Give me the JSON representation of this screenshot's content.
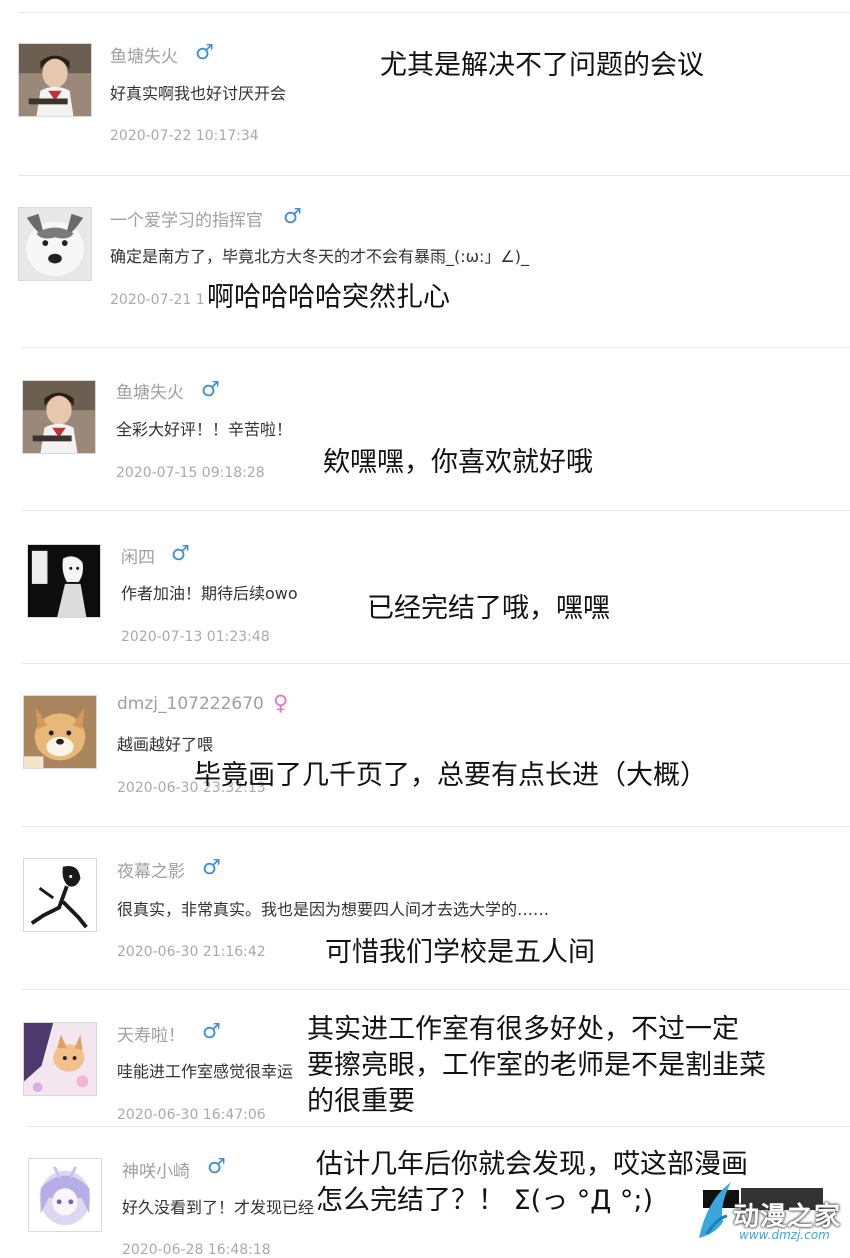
{
  "colors": {
    "male": "#3f8fd8",
    "female": "#e777c4",
    "username": "#a0a0a0",
    "timestamp": "#aaaaaa",
    "divider": "#e6e6e6"
  },
  "comments": [
    {
      "username": "鱼塘失火",
      "gender_icon": "♂",
      "gender": "male",
      "text": "好真实啊我也好讨厌开会",
      "time": "2020-07-22 10:17:34",
      "reply": "尤其是解决不了问题的会议"
    },
    {
      "username": "一个爱学习的指挥官",
      "gender_icon": "♂",
      "gender": "male",
      "text": "确定是南方了，毕竟北方大冬天的才不会有暴雨_(:ω:」∠)_",
      "time": "2020-07-21 1",
      "reply": "啊哈哈哈哈突然扎心"
    },
    {
      "username": "鱼塘失火",
      "gender_icon": "♂",
      "gender": "male",
      "text": "全彩大好评！！辛苦啦！",
      "time": "2020-07-15 09:18:28",
      "reply": "欸嘿嘿，你喜欢就好哦"
    },
    {
      "username": "闲四",
      "gender_icon": "♂",
      "gender": "male",
      "text": "作者加油！期待后续owo",
      "time": "2020-07-13 01:23:48",
      "reply": "已经完结了哦，嘿嘿"
    },
    {
      "username": "dmzj_107222670",
      "gender_icon": "♀",
      "gender": "female",
      "text": "越画越好了喂",
      "time": "2020-06-30 23:32:13",
      "reply": "毕竟画了几千页了，总要有点长进（大概）"
    },
    {
      "username": "夜幕之影",
      "gender_icon": "♂",
      "gender": "male",
      "text": "很真实，非常真实。我也是因为想要四人间才去选大学的……",
      "time": "2020-06-30 21:16:42",
      "reply": "可惜我们学校是五人间"
    },
    {
      "username": "天寿啦！",
      "gender_icon": "♂",
      "gender": "male",
      "text": "哇能进工作室感觉很幸运",
      "time": "2020-06-30 16:47:06",
      "reply_lines": [
        "其实进工作室有很多好处，不过一定",
        "要擦亮眼，工作室的老师是不是割韭菜",
        "的很重要"
      ]
    },
    {
      "username": "神咲小崎",
      "gender_icon": "♂",
      "gender": "male",
      "text": "好久没看到了！才发现已经",
      "time": "2020-06-28 16:48:18",
      "reply_lines": [
        "估计几年后你就会发现，哎这部漫画",
        "怎么完结了？！ Σ(っ °Д °;)"
      ]
    }
  ],
  "watermark": {
    "name": "动漫之家",
    "url": "www.dmzj.com"
  }
}
